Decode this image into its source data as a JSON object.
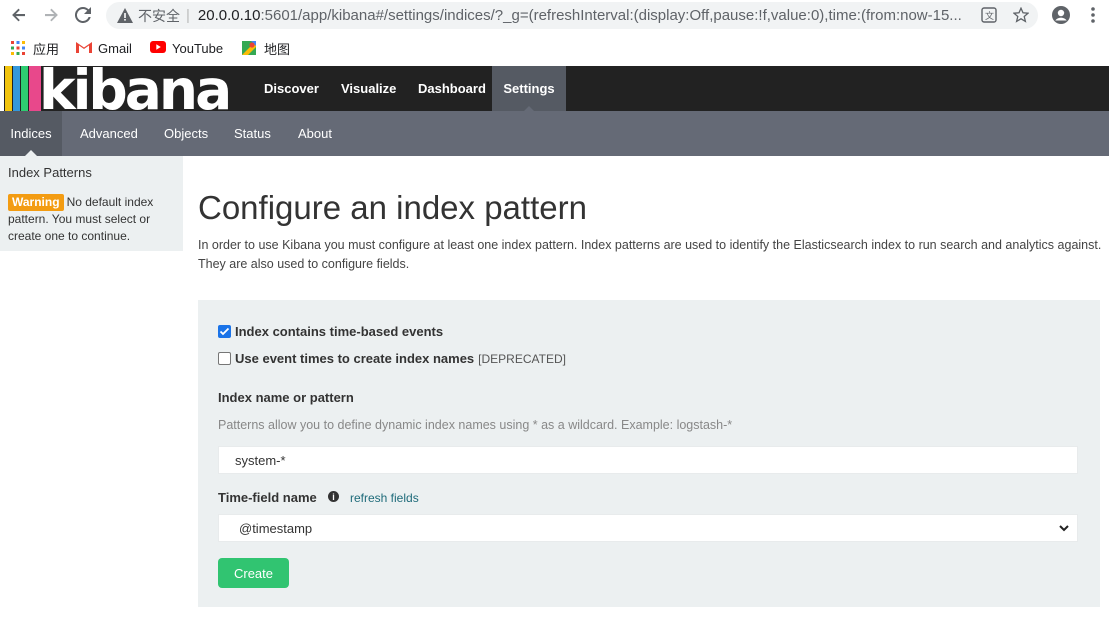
{
  "browser": {
    "insecure_label": "不安全",
    "url_host": "20.0.0.10",
    "url_rest": ":5601/app/kibana#/settings/indices/?_g=(refreshInterval:(display:Off,pause:!f,value:0),time:(from:now-15...",
    "bookmarks": [
      {
        "label": "应用",
        "icon": "apps-grid-icon"
      },
      {
        "label": "Gmail",
        "icon": "gmail-icon"
      },
      {
        "label": "YouTube",
        "icon": "youtube-icon"
      },
      {
        "label": "地图",
        "icon": "maps-icon"
      }
    ]
  },
  "kibana": {
    "logo_text": "kibana",
    "nav": [
      {
        "label": "Discover"
      },
      {
        "label": "Visualize"
      },
      {
        "label": "Dashboard"
      },
      {
        "label": "Settings",
        "active": true
      }
    ],
    "subnav": [
      {
        "label": "Indices",
        "active": true
      },
      {
        "label": "Advanced"
      },
      {
        "label": "Objects"
      },
      {
        "label": "Status"
      },
      {
        "label": "About"
      }
    ]
  },
  "sidebar": {
    "title": "Index Patterns",
    "warning_badge": "Warning",
    "warning_text": "No default index pattern. You must select or create one to continue."
  },
  "main": {
    "title": "Configure an index pattern",
    "intro": "In order to use Kibana you must configure at least one index pattern. Index patterns are used to identify the Elasticsearch index to run search and analytics against. They are also used to configure fields.",
    "time_based_label": "Index contains time-based events",
    "time_based_checked": true,
    "event_times_label": "Use event times to create index names",
    "event_times_checked": false,
    "deprecated_tag": "[DEPRECATED]",
    "index_name_label": "Index name or pattern",
    "index_help": "Patterns allow you to define dynamic index names using * as a wildcard. Example: logstash-*",
    "index_value": "system-*",
    "time_field_label": "Time-field name",
    "refresh_link": "refresh fields",
    "time_field_value": "@timestamp",
    "create_label": "Create"
  },
  "colors": {
    "header_bg": "#222222",
    "subnav_bg": "#656a76",
    "active_tab_bg": "#555a63",
    "panel_bg": "#ecf0f1",
    "create_btn": "#31c471",
    "warning_badge": "#f39c12",
    "link": "#1f6b7a"
  }
}
